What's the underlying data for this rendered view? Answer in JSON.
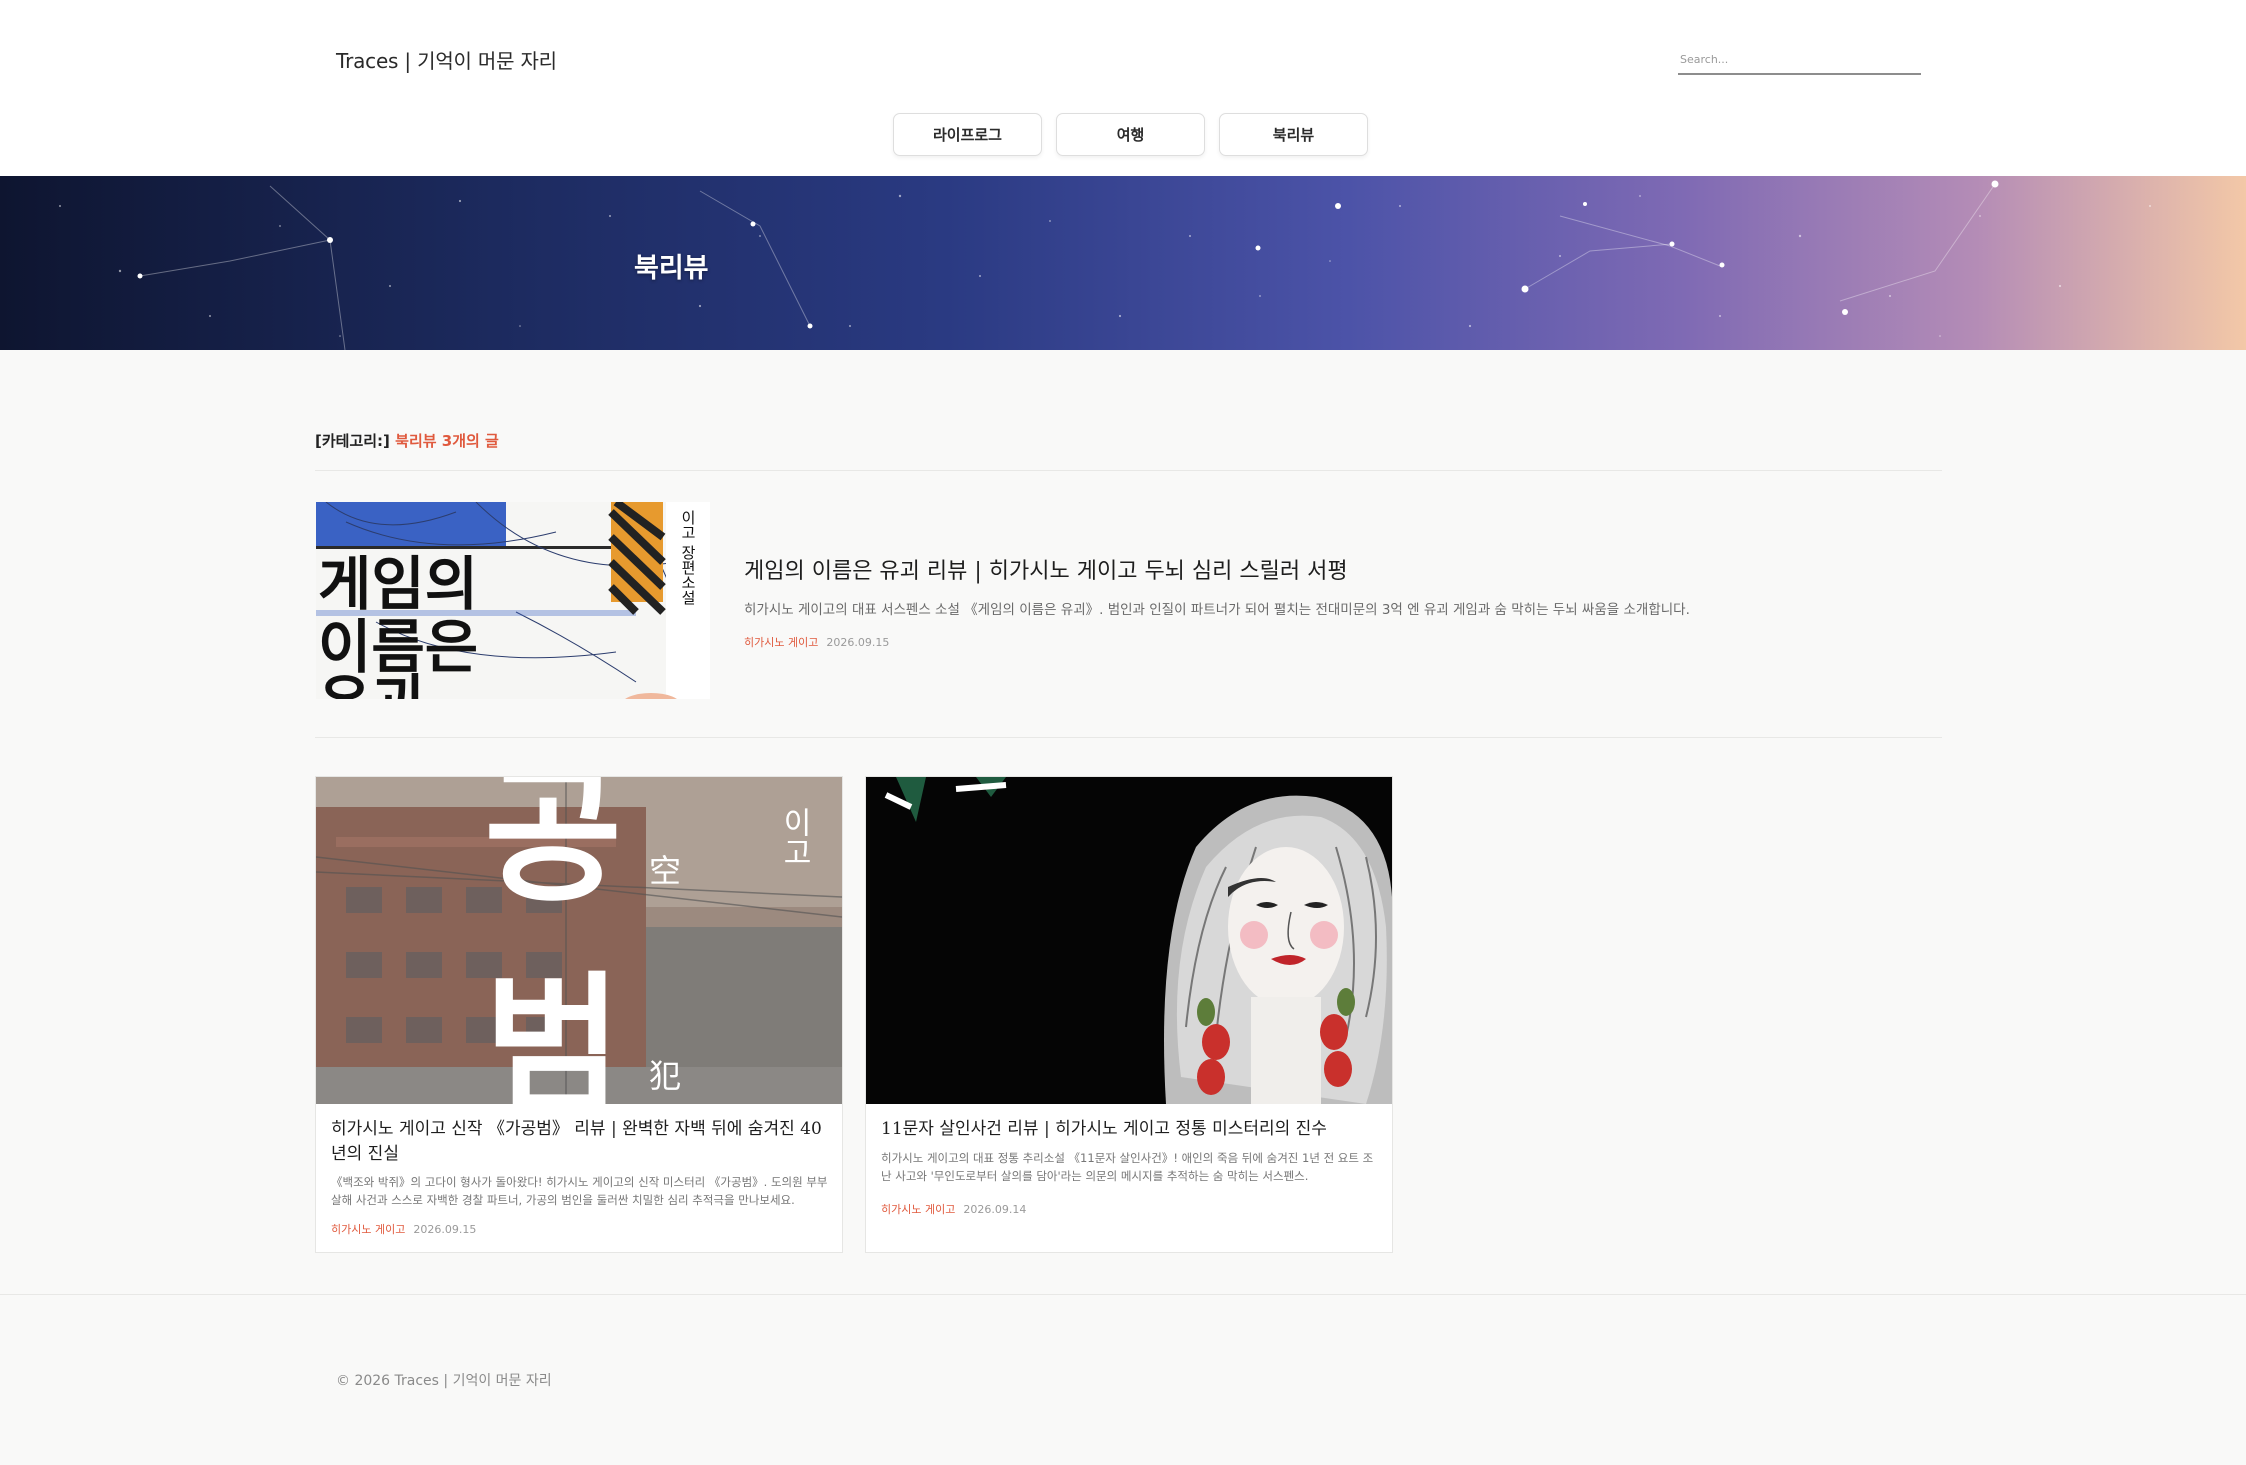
{
  "header": {
    "site_title": "Traces | 기억이 머문 자리",
    "search_placeholder": "Search..."
  },
  "nav": {
    "items": [
      {
        "label": "라이프로그"
      },
      {
        "label": "여행"
      },
      {
        "label": "북리뷰"
      }
    ]
  },
  "banner": {
    "title": "북리뷰"
  },
  "category": {
    "prefix": "[카테고리:]",
    "name_count": "북리뷰 3개의 글"
  },
  "posts": [
    {
      "title": "게임의 이름은 유괴 리뷰 | 히가시노 게이고 두뇌 심리 스릴러 서평",
      "excerpt": "히가시노 게이고의 대표 서스펜스 소설 《게임의 이름은 유괴》. 범인과 인질이 파트너가 되어 펼치는 전대미문의 3억 엔 유괴 게임과 숨 막히는 두뇌 싸움을 소개합니다.",
      "author": "히가시노 게이고",
      "date": "2026.09.15",
      "cover_text": {
        "title_line1": "게임의",
        "title_line2": "이름은",
        "title_line3": "유괴",
        "vertical": "이고 장편소설"
      }
    },
    {
      "title": "히가시노 게이고 신작 《가공범》 리뷰 | 완벽한 자백 뒤에 숨겨진 40년의 진실",
      "excerpt": "《백조와 박쥐》의 고다이 형사가 돌아왔다! 히가시노 게이고의 신작 미스터리 《가공범》. 도의원 부부 살해 사건과 스스로 자백한 경찰 파트너, 가공의 범인을 둘러싼 치밀한 심리 추적극을 만나보세요.",
      "author": "히가시노 게이고",
      "date": "2026.09.15",
      "cover_text": {
        "big1": "공",
        "big2": "범",
        "small1": "空",
        "small2": "犯",
        "corner": "이고"
      }
    },
    {
      "title": "11문자 살인사건 리뷰 | 히가시노 게이고 정통 미스터리의 진수",
      "excerpt": "히가시노 게이고의 대표 정통 추리소설 《11문자 살인사건》! 애인의 죽음 뒤에 숨겨진 1년 전 요트 조난 사고와 '무인도로부터 살의를 담아'라는 의문의 메시지를 추적하는 숨 막히는 서스펜스.",
      "author": "히가시노 게이고",
      "date": "2026.09.14"
    }
  ],
  "footer": {
    "copyright": "© 2026 Traces | 기억이 머문 자리"
  }
}
